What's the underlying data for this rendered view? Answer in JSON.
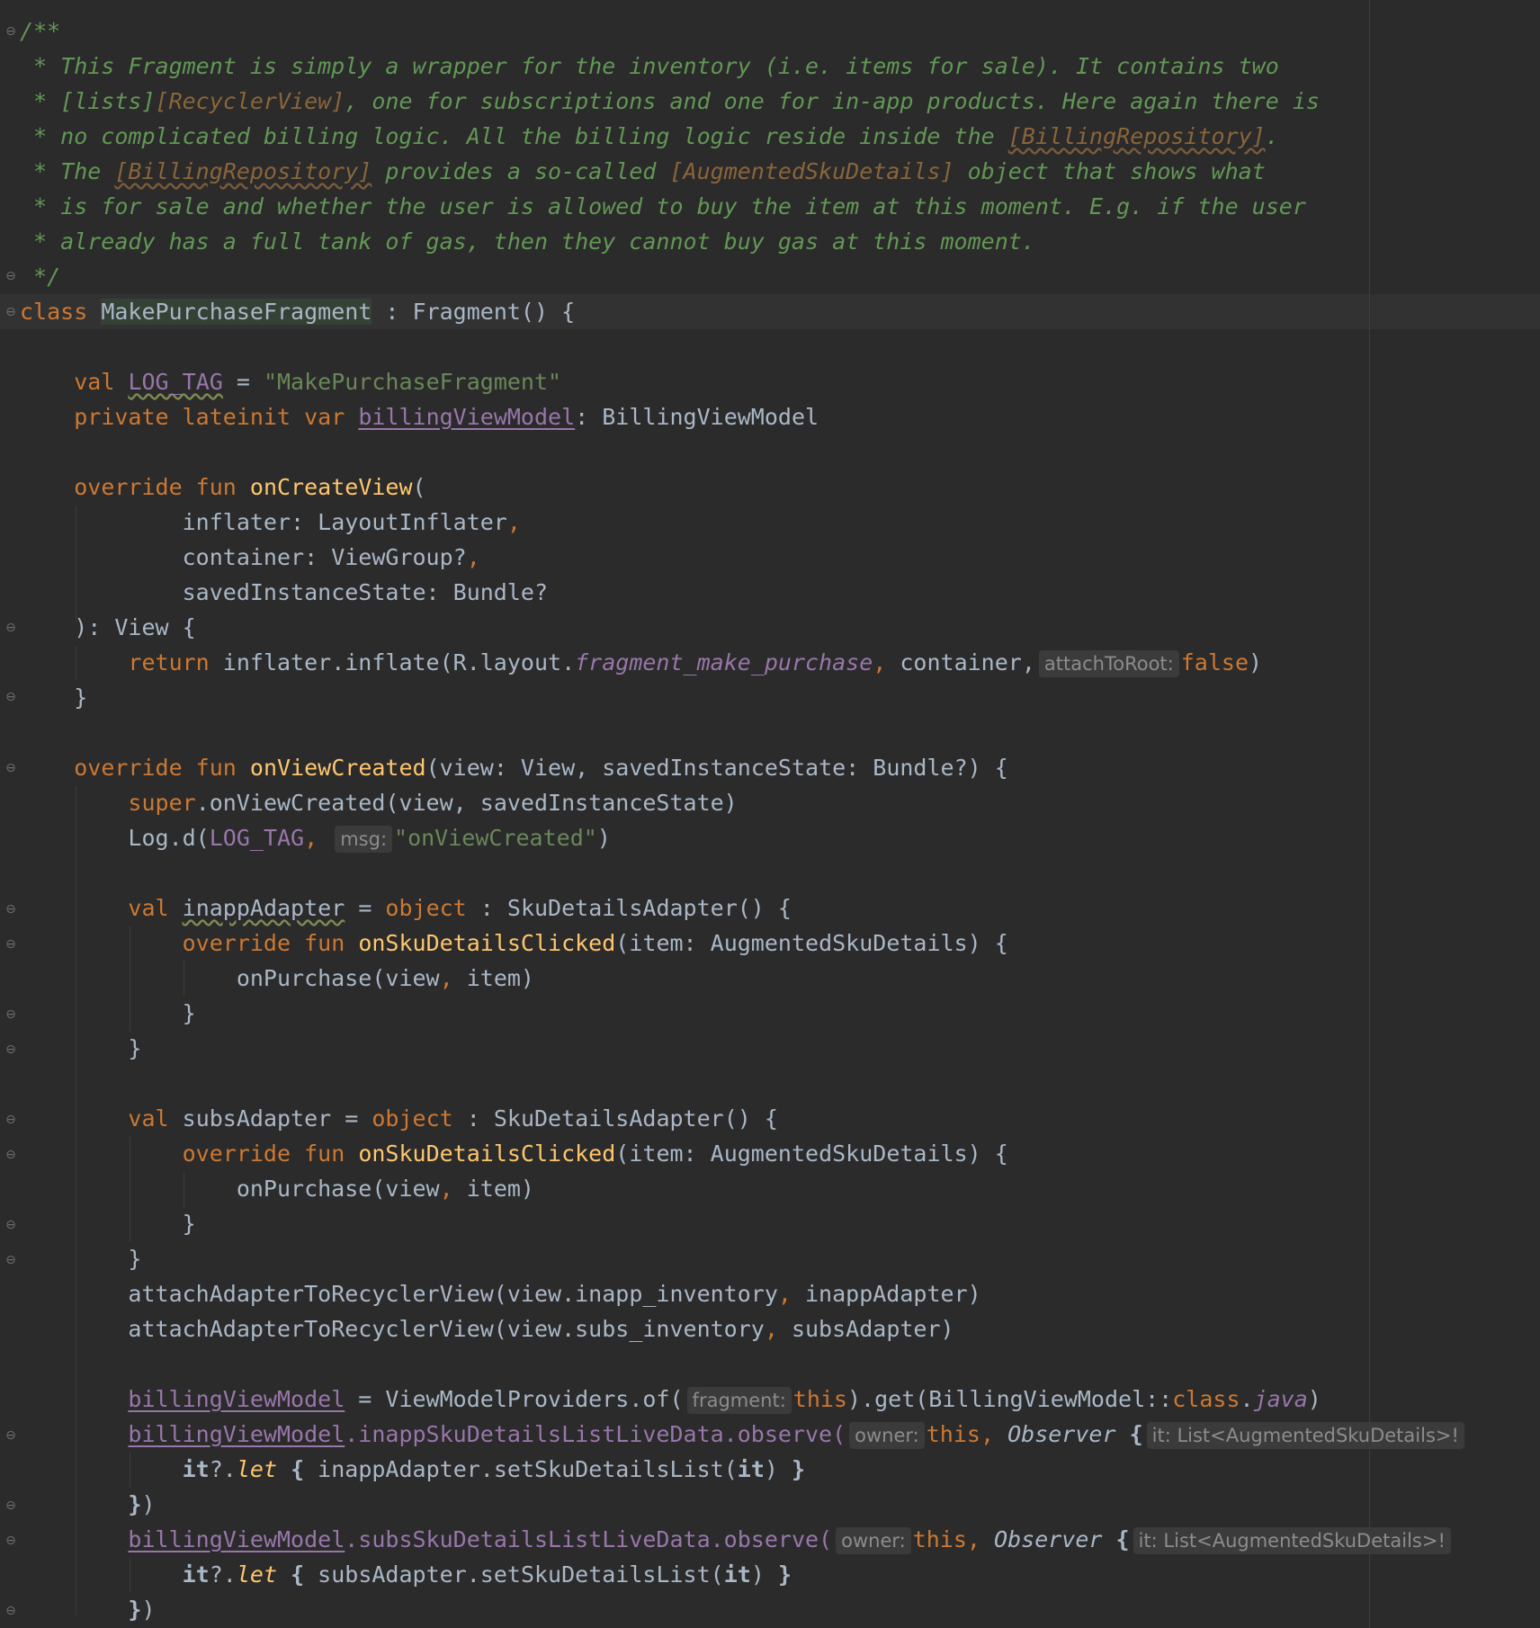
{
  "doc_comment": {
    "l1": "/**",
    "l2": " * This Fragment is simply a wrapper for the inventory (i.e. items for sale). It contains two",
    "l3a": " * [lists]",
    "l3b": "[RecyclerView]",
    "l3c": ", one for subscriptions and one for in-app products. Here again there is",
    "l4a": " * no complicated billing logic. All the billing logic reside inside the ",
    "l4b": "[BillingRepository]",
    "l4c": ".",
    "l5a": " * The ",
    "l5b": "[BillingRepository]",
    "l5c": " provides a so-called ",
    "l5d": "[AugmentedSkuDetails]",
    "l5e": " object that shows what",
    "l6": " * is for sale and whether the user is allowed to buy the item at this moment. E.g. if the user",
    "l7": " * already has a full tank of gas, then they cannot buy gas at this moment.",
    "l8": " */"
  },
  "code": {
    "kw_class": "class",
    "class_name": "MakePurchaseFragment",
    "class_rest": " : Fragment() {",
    "kw_val": "val",
    "kw_private_lateinit_var": "private lateinit var",
    "kw_override_fun": "override fun",
    "kw_return": "return",
    "kw_super": "super",
    "kw_object": "object",
    "kw_this": "this",
    "kw_false": "false",
    "kw_class_ref": "class",
    "log_tag_name": "LOG_TAG",
    "log_tag_value": "\"MakePurchaseFragment\"",
    "vm_name": "billingViewModel",
    "vm_type": ": BillingViewModel",
    "on_create_view": "onCreateView",
    "param_inflater": "inflater: LayoutInflater",
    "param_container": "container: ViewGroup?",
    "param_saved": "savedInstanceState: Bundle?",
    "returns_view": "): View {",
    "inflate_call": " inflater.inflate(R.layout.",
    "layout_name": "fragment_make_purchase",
    "container_arg": " container,",
    "on_view_created": "onViewCreated",
    "on_view_created_params": "(view: View, savedInstanceState: Bundle?) {",
    "super_call": ".onViewCreated(view, savedInstanceState)",
    "log_d": "Log.d(",
    "on_view_created_str": "\"onViewCreated\"",
    "inapp_adapter": "inappAdapter",
    "subs_adapter": "subsAdapter",
    "sku_adapter_type": " : SkuDetailsAdapter() {",
    "on_sku_clicked": "onSkuDetailsClicked",
    "on_sku_params": "(item: AugmentedSkuDetails) {",
    "on_purchase": "onPurchase(view",
    "item_arg": " item)",
    "attach_inapp_a": "attachAdapterToRecyclerView(view.inapp_inventory",
    "attach_inapp_b": " inappAdapter)",
    "attach_subs_a": "attachAdapterToRecyclerView(view.subs_inventory",
    "attach_subs_b": " subsAdapter)",
    "vm_providers": " = ViewModelProviders.of(",
    "vm_get": ").get(BillingViewModel::",
    "java": "java",
    "inapp_live": ".inappSkuDetailsListLiveData.observe(",
    "subs_live": ".subsSkuDetailsListLiveData.observe(",
    "observer": "Observer",
    "it": "it",
    "let": "let",
    "inapp_set": " inappAdapter.setSkuDetailsList(",
    "subs_set": " subsAdapter.setSkuDetailsList("
  },
  "hints": {
    "attach_to_root": "attachToRoot:",
    "msg": "msg:",
    "fragment": "fragment:",
    "owner": "owner:",
    "it_type": "it: List<AugmentedSkuDetails>!"
  }
}
